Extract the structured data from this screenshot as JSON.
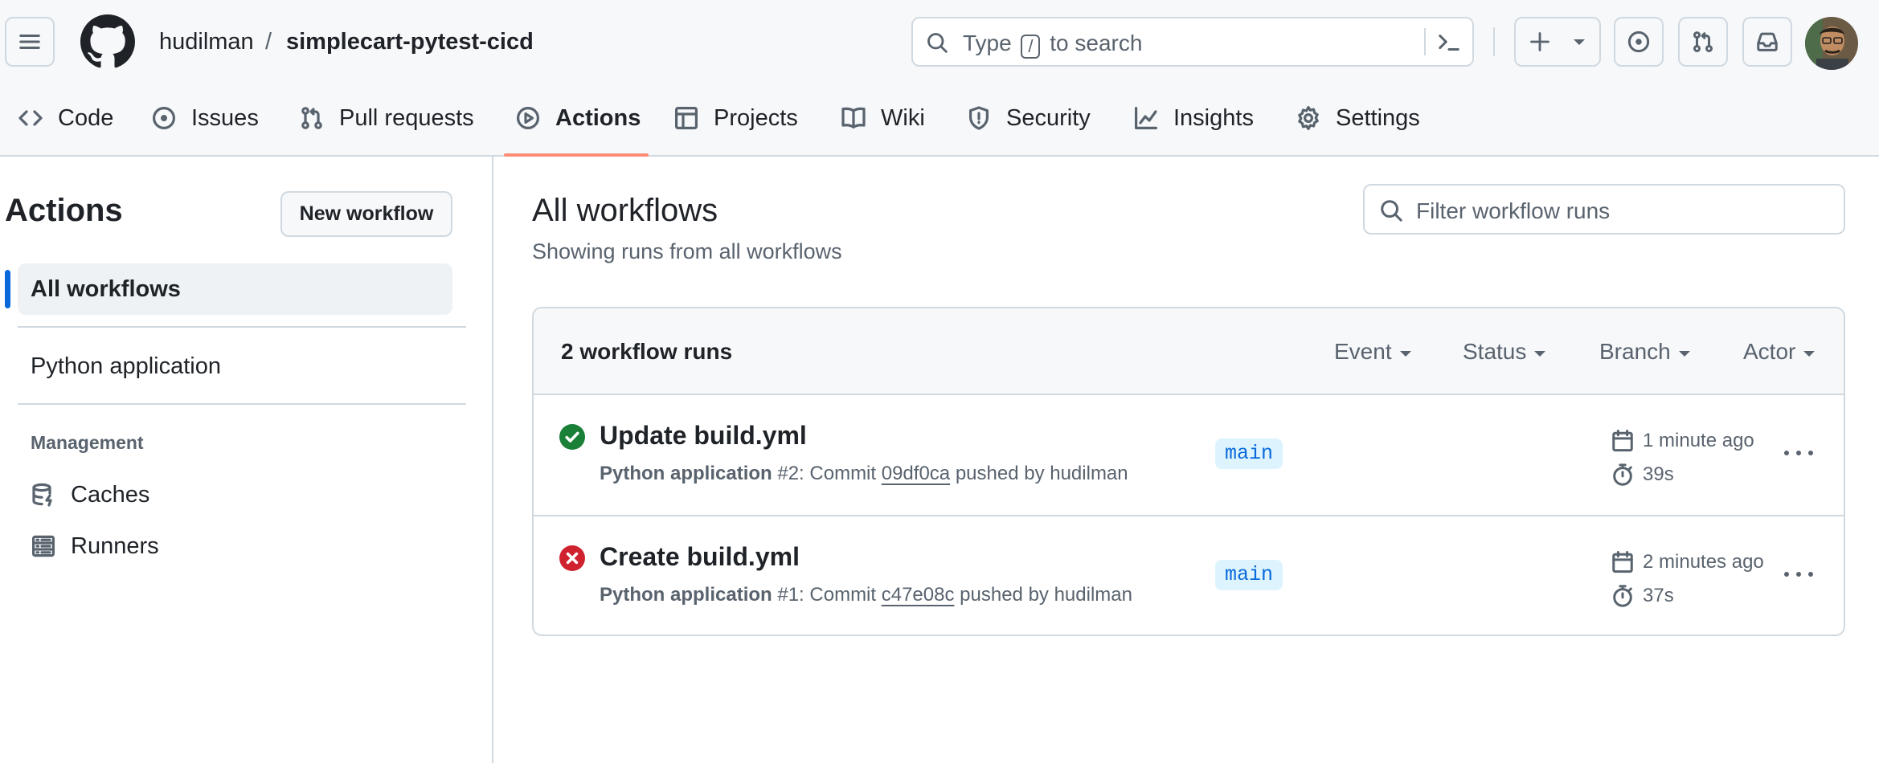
{
  "header": {
    "owner": "hudilman",
    "separator": "/",
    "repo": "simplecart-pytest-cicd",
    "search": {
      "prefix": "Type",
      "key": "/",
      "suffix": "to search"
    }
  },
  "nav": {
    "tabs": [
      {
        "label": "Code",
        "icon": "code-icon"
      },
      {
        "label": "Issues",
        "icon": "issue-icon"
      },
      {
        "label": "Pull requests",
        "icon": "pull-request-icon"
      },
      {
        "label": "Actions",
        "icon": "play-icon",
        "active": true
      },
      {
        "label": "Projects",
        "icon": "table-icon"
      },
      {
        "label": "Wiki",
        "icon": "book-icon"
      },
      {
        "label": "Security",
        "icon": "shield-icon"
      },
      {
        "label": "Insights",
        "icon": "graph-icon"
      },
      {
        "label": "Settings",
        "icon": "gear-icon"
      }
    ]
  },
  "sidebar": {
    "title": "Actions",
    "new_workflow": "New workflow",
    "items": [
      {
        "label": "All workflows",
        "selected": true
      },
      {
        "label": "Python application"
      }
    ],
    "management_heading": "Management",
    "management": [
      {
        "label": "Caches",
        "icon": "database-icon"
      },
      {
        "label": "Runners",
        "icon": "server-icon"
      }
    ]
  },
  "main": {
    "title": "All workflows",
    "subtitle": "Showing runs from all workflows",
    "filter_placeholder": "Filter workflow runs",
    "runs_count": "2 workflow runs",
    "filters": [
      "Event",
      "Status",
      "Branch",
      "Actor"
    ],
    "runs": [
      {
        "title": "Update build.yml",
        "status": "success",
        "workflow": "Python application",
        "number_text": "#2: Commit",
        "sha": "09df0ca",
        "pushed_by": "pushed by hudilman",
        "branch": "main",
        "time": "1 minute ago",
        "duration": "39s"
      },
      {
        "title": "Create build.yml",
        "status": "failure",
        "workflow": "Python application",
        "number_text": "#1: Commit",
        "sha": "c47e08c",
        "pushed_by": "pushed by hudilman",
        "branch": "main",
        "time": "2 minutes ago",
        "duration": "37s"
      }
    ]
  },
  "colors": {
    "accent": "#0969da",
    "success": "#1a7f37",
    "danger": "#cf222e",
    "tab_underline": "#fd8c73"
  }
}
